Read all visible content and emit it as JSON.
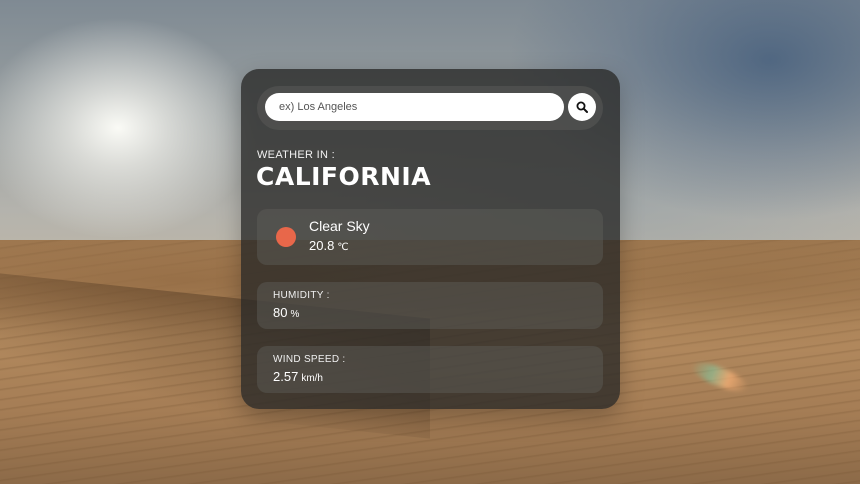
{
  "search": {
    "placeholder": "ex) Los Angeles",
    "icon": "search-icon"
  },
  "location": {
    "label": "WEATHER IN :",
    "city": "CALIFORNIA"
  },
  "condition": {
    "icon": "sun-icon",
    "icon_color": "#e8674a",
    "description": "Clear Sky",
    "temperature": "20.8",
    "temperature_unit": "℃"
  },
  "humidity": {
    "label": "HUMIDITY :",
    "value": "80",
    "unit": "%"
  },
  "wind": {
    "label": "WIND SPEED :",
    "value": "2.57",
    "unit": "km/h"
  }
}
